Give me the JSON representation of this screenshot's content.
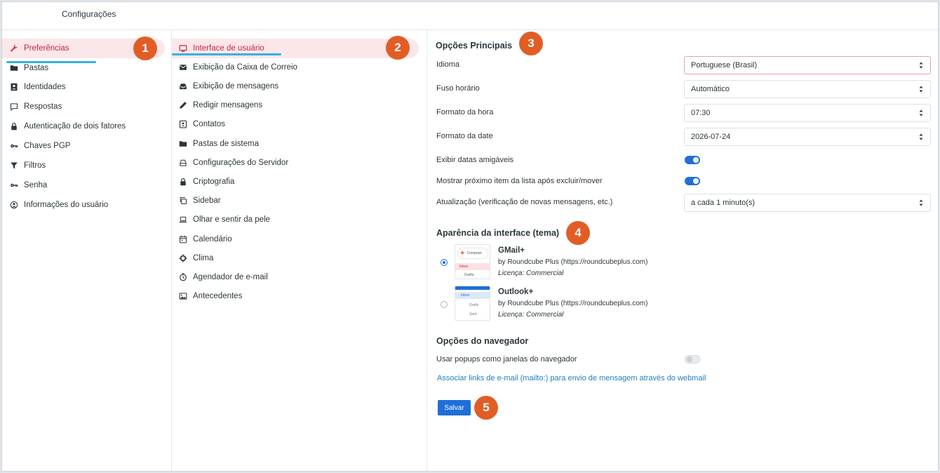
{
  "header": {
    "title": "Configurações"
  },
  "sidebar": {
    "items": [
      {
        "label": "Preferências",
        "icon": "wrench-icon"
      },
      {
        "label": "Pastas",
        "icon": "folder-icon"
      },
      {
        "label": "Identidades",
        "icon": "id-badge-icon"
      },
      {
        "label": "Respostas",
        "icon": "comment-icon"
      },
      {
        "label": "Autenticação de dois fatores",
        "icon": "lock-icon"
      },
      {
        "label": "Chaves PGP",
        "icon": "key-icon"
      },
      {
        "label": "Filtros",
        "icon": "filter-icon"
      },
      {
        "label": "Senha",
        "icon": "key-icon"
      },
      {
        "label": "Informações do usuário",
        "icon": "user-circle-icon"
      }
    ]
  },
  "sections": {
    "items": [
      {
        "label": "Interface de usuário",
        "icon": "monitor-icon"
      },
      {
        "label": "Exibição da Caixa de Correio",
        "icon": "envelope-icon"
      },
      {
        "label": "Exibição de mensagens",
        "icon": "inbox-icon"
      },
      {
        "label": "Redigir mensagens",
        "icon": "pencil-icon"
      },
      {
        "label": "Contatos",
        "icon": "address-book-icon"
      },
      {
        "label": "Pastas de sistema",
        "icon": "folder-icon"
      },
      {
        "label": "Configurações do Servidor",
        "icon": "server-icon"
      },
      {
        "label": "Criptografia",
        "icon": "lock-icon"
      },
      {
        "label": "Sidebar",
        "icon": "copy-icon"
      },
      {
        "label": "Olhar e sentir da pele",
        "icon": "laptop-icon"
      },
      {
        "label": "Calendário",
        "icon": "calendar-icon"
      },
      {
        "label": "Clima",
        "icon": "sun-icon"
      },
      {
        "label": "Agendador de e-mail",
        "icon": "clock-icon"
      },
      {
        "label": "Antecedentes",
        "icon": "image-icon"
      }
    ]
  },
  "badges": [
    "1",
    "2",
    "3",
    "4",
    "5"
  ],
  "main": {
    "options_title": "Opções Principais",
    "language_label": "Idioma",
    "language_value": "Portuguese (Brasil)",
    "timezone_label": "Fuso horário",
    "timezone_value": "Automático",
    "timeformat_label": "Formato da hora",
    "timeformat_value": "07:30",
    "dateformat_label": "Formato da date",
    "dateformat_value": "2026-07-24",
    "friendly_dates_label": "Exibir datas amigáveis",
    "friendly_dates_on": true,
    "next_item_label": "Mostrar próximo item da lista após excluir/mover",
    "next_item_on": true,
    "refresh_label": "Atualização (verificação de novas mensagens, etc.)",
    "refresh_value": "a cada 1 minuto(s)",
    "theme_title": "Aparência da interface (tema)",
    "themes": [
      {
        "name": "GMail+",
        "by": "by Roundcube Plus (https://roundcubeplus.com)",
        "license": "Licença: Commercial",
        "selected": true,
        "thumb": {
          "compose": "Compose",
          "inbox": "Inbox",
          "drafts": "Drafts"
        }
      },
      {
        "name": "Outlook+",
        "by": "by Roundcube Plus (https://roundcubeplus.com)",
        "license": "Licença: Commercial",
        "selected": false,
        "thumb": {
          "inbox": "Inbox",
          "drafts": "Drafts",
          "sent": "Sent"
        }
      }
    ],
    "browser_title": "Opções do navegador",
    "popups_label": "Usar popups como janelas do navegador",
    "popups_on": false,
    "mailto_link": "Associar links de e-mail (mailto:) para envio de mensagem através do webmail",
    "save_label": "Salvar"
  },
  "colors": {
    "accent": "#1e6fd9",
    "active_bg": "#fbe7ea",
    "active_text": "#c1273c",
    "badge": "#e25d26",
    "underline": "#36b2e5",
    "link": "#1f7ec2"
  }
}
